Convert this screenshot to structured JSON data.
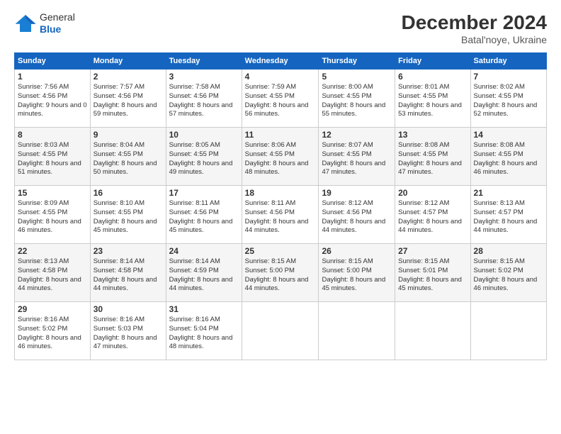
{
  "header": {
    "logo_general": "General",
    "logo_blue": "Blue",
    "month_title": "December 2024",
    "location": "Batal'noye, Ukraine"
  },
  "days_of_week": [
    "Sunday",
    "Monday",
    "Tuesday",
    "Wednesday",
    "Thursday",
    "Friday",
    "Saturday"
  ],
  "weeks": [
    [
      {
        "day": "1",
        "sunrise": "Sunrise: 7:56 AM",
        "sunset": "Sunset: 4:56 PM",
        "daylight": "Daylight: 9 hours and 0 minutes."
      },
      {
        "day": "2",
        "sunrise": "Sunrise: 7:57 AM",
        "sunset": "Sunset: 4:56 PM",
        "daylight": "Daylight: 8 hours and 59 minutes."
      },
      {
        "day": "3",
        "sunrise": "Sunrise: 7:58 AM",
        "sunset": "Sunset: 4:56 PM",
        "daylight": "Daylight: 8 hours and 57 minutes."
      },
      {
        "day": "4",
        "sunrise": "Sunrise: 7:59 AM",
        "sunset": "Sunset: 4:55 PM",
        "daylight": "Daylight: 8 hours and 56 minutes."
      },
      {
        "day": "5",
        "sunrise": "Sunrise: 8:00 AM",
        "sunset": "Sunset: 4:55 PM",
        "daylight": "Daylight: 8 hours and 55 minutes."
      },
      {
        "day": "6",
        "sunrise": "Sunrise: 8:01 AM",
        "sunset": "Sunset: 4:55 PM",
        "daylight": "Daylight: 8 hours and 53 minutes."
      },
      {
        "day": "7",
        "sunrise": "Sunrise: 8:02 AM",
        "sunset": "Sunset: 4:55 PM",
        "daylight": "Daylight: 8 hours and 52 minutes."
      }
    ],
    [
      {
        "day": "8",
        "sunrise": "Sunrise: 8:03 AM",
        "sunset": "Sunset: 4:55 PM",
        "daylight": "Daylight: 8 hours and 51 minutes."
      },
      {
        "day": "9",
        "sunrise": "Sunrise: 8:04 AM",
        "sunset": "Sunset: 4:55 PM",
        "daylight": "Daylight: 8 hours and 50 minutes."
      },
      {
        "day": "10",
        "sunrise": "Sunrise: 8:05 AM",
        "sunset": "Sunset: 4:55 PM",
        "daylight": "Daylight: 8 hours and 49 minutes."
      },
      {
        "day": "11",
        "sunrise": "Sunrise: 8:06 AM",
        "sunset": "Sunset: 4:55 PM",
        "daylight": "Daylight: 8 hours and 48 minutes."
      },
      {
        "day": "12",
        "sunrise": "Sunrise: 8:07 AM",
        "sunset": "Sunset: 4:55 PM",
        "daylight": "Daylight: 8 hours and 47 minutes."
      },
      {
        "day": "13",
        "sunrise": "Sunrise: 8:08 AM",
        "sunset": "Sunset: 4:55 PM",
        "daylight": "Daylight: 8 hours and 47 minutes."
      },
      {
        "day": "14",
        "sunrise": "Sunrise: 8:08 AM",
        "sunset": "Sunset: 4:55 PM",
        "daylight": "Daylight: 8 hours and 46 minutes."
      }
    ],
    [
      {
        "day": "15",
        "sunrise": "Sunrise: 8:09 AM",
        "sunset": "Sunset: 4:55 PM",
        "daylight": "Daylight: 8 hours and 46 minutes."
      },
      {
        "day": "16",
        "sunrise": "Sunrise: 8:10 AM",
        "sunset": "Sunset: 4:55 PM",
        "daylight": "Daylight: 8 hours and 45 minutes."
      },
      {
        "day": "17",
        "sunrise": "Sunrise: 8:11 AM",
        "sunset": "Sunset: 4:56 PM",
        "daylight": "Daylight: 8 hours and 45 minutes."
      },
      {
        "day": "18",
        "sunrise": "Sunrise: 8:11 AM",
        "sunset": "Sunset: 4:56 PM",
        "daylight": "Daylight: 8 hours and 44 minutes."
      },
      {
        "day": "19",
        "sunrise": "Sunrise: 8:12 AM",
        "sunset": "Sunset: 4:56 PM",
        "daylight": "Daylight: 8 hours and 44 minutes."
      },
      {
        "day": "20",
        "sunrise": "Sunrise: 8:12 AM",
        "sunset": "Sunset: 4:57 PM",
        "daylight": "Daylight: 8 hours and 44 minutes."
      },
      {
        "day": "21",
        "sunrise": "Sunrise: 8:13 AM",
        "sunset": "Sunset: 4:57 PM",
        "daylight": "Daylight: 8 hours and 44 minutes."
      }
    ],
    [
      {
        "day": "22",
        "sunrise": "Sunrise: 8:13 AM",
        "sunset": "Sunset: 4:58 PM",
        "daylight": "Daylight: 8 hours and 44 minutes."
      },
      {
        "day": "23",
        "sunrise": "Sunrise: 8:14 AM",
        "sunset": "Sunset: 4:58 PM",
        "daylight": "Daylight: 8 hours and 44 minutes."
      },
      {
        "day": "24",
        "sunrise": "Sunrise: 8:14 AM",
        "sunset": "Sunset: 4:59 PM",
        "daylight": "Daylight: 8 hours and 44 minutes."
      },
      {
        "day": "25",
        "sunrise": "Sunrise: 8:15 AM",
        "sunset": "Sunset: 5:00 PM",
        "daylight": "Daylight: 8 hours and 44 minutes."
      },
      {
        "day": "26",
        "sunrise": "Sunrise: 8:15 AM",
        "sunset": "Sunset: 5:00 PM",
        "daylight": "Daylight: 8 hours and 45 minutes."
      },
      {
        "day": "27",
        "sunrise": "Sunrise: 8:15 AM",
        "sunset": "Sunset: 5:01 PM",
        "daylight": "Daylight: 8 hours and 45 minutes."
      },
      {
        "day": "28",
        "sunrise": "Sunrise: 8:15 AM",
        "sunset": "Sunset: 5:02 PM",
        "daylight": "Daylight: 8 hours and 46 minutes."
      }
    ],
    [
      {
        "day": "29",
        "sunrise": "Sunrise: 8:16 AM",
        "sunset": "Sunset: 5:02 PM",
        "daylight": "Daylight: 8 hours and 46 minutes."
      },
      {
        "day": "30",
        "sunrise": "Sunrise: 8:16 AM",
        "sunset": "Sunset: 5:03 PM",
        "daylight": "Daylight: 8 hours and 47 minutes."
      },
      {
        "day": "31",
        "sunrise": "Sunrise: 8:16 AM",
        "sunset": "Sunset: 5:04 PM",
        "daylight": "Daylight: 8 hours and 48 minutes."
      },
      null,
      null,
      null,
      null
    ]
  ]
}
